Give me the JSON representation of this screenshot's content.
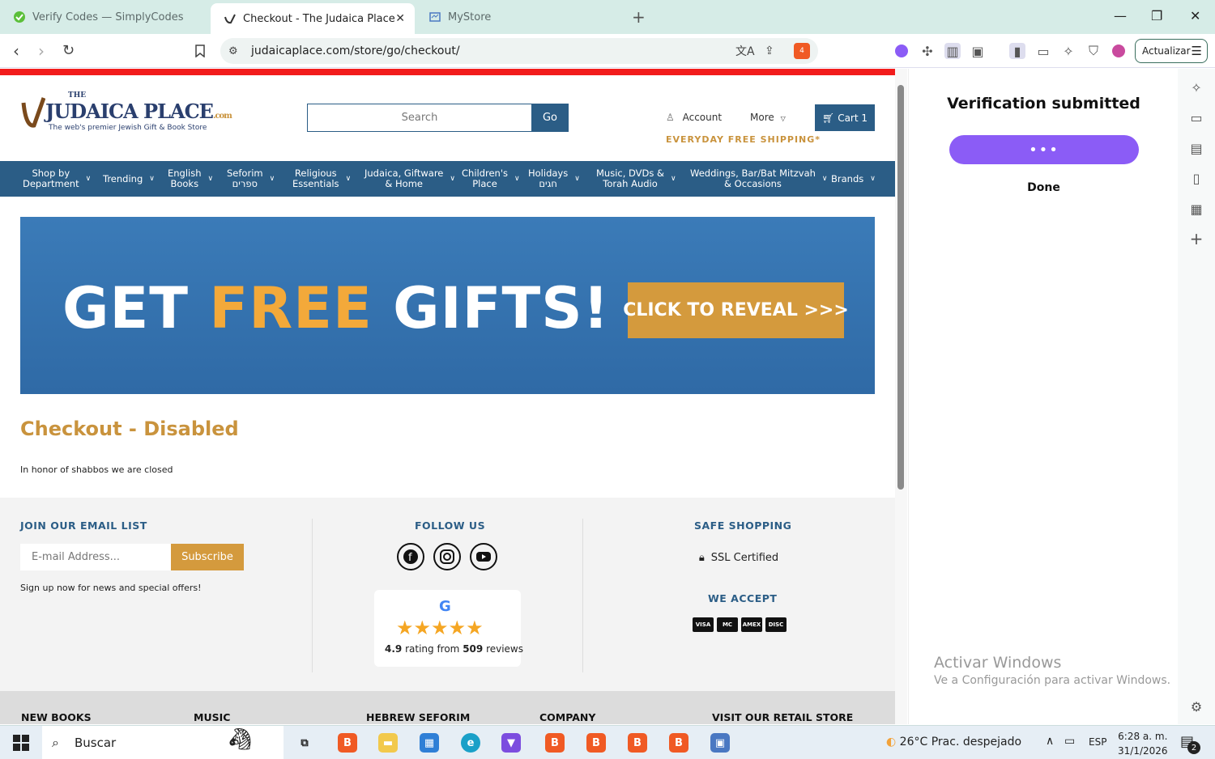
{
  "browser": {
    "tabs": [
      {
        "label": "Verify Codes — SimplyCodes",
        "active": false
      },
      {
        "label": "Checkout - The Judaica Place",
        "active": true
      },
      {
        "label": "MyStore",
        "active": false
      }
    ],
    "url": "judaicaplace.com/store/go/checkout/",
    "update_label": "Actualizar",
    "shield_count": "4"
  },
  "site": {
    "logo_the": "THE",
    "logo_main": "JUDAICA PLACE",
    "logo_com": ".com",
    "logo_tagline": "The web's premier Jewish Gift & Book Store",
    "search_placeholder": "Search",
    "go_label": "Go",
    "account_label": "Account",
    "more_label": "More",
    "cart_label": "Cart 1",
    "shipping_text": "EVERYDAY FREE SHIPPING*",
    "menu": [
      {
        "l1": "Shop by",
        "l2": "Department"
      },
      {
        "l1": "Trending",
        "l2": ""
      },
      {
        "l1": "English",
        "l2": "Books"
      },
      {
        "l1": "Seforim",
        "l2": "ספרים"
      },
      {
        "l1": "Religious",
        "l2": "Essentials"
      },
      {
        "l1": "Judaica, Giftware",
        "l2": "& Home"
      },
      {
        "l1": "Children's",
        "l2": "Place"
      },
      {
        "l1": "Holidays",
        "l2": "חגים"
      },
      {
        "l1": "Music, DVDs &",
        "l2": "Torah Audio"
      },
      {
        "l1": "Weddings, Bar/Bat Mitzvah",
        "l2": "& Occasions"
      },
      {
        "l1": "Brands",
        "l2": ""
      }
    ],
    "banner": {
      "get": "GET ",
      "free": "FREE",
      "gifts": " GIFTS!",
      "reveal": "CLICK TO REVEAL >>>"
    },
    "checkout_title": "Checkout - Disabled",
    "honor_text": "In honor of shabbos we are closed",
    "footer": {
      "email_heading": "JOIN OUR EMAIL LIST",
      "email_placeholder": "E-mail Address...",
      "subscribe_label": "Subscribe",
      "signup_text": "Sign up now for news and special offers!",
      "follow_heading": "FOLLOW US",
      "google_letter": "G",
      "stars": "★★★★★",
      "rating_value": "4.9",
      "rating_mid": " rating from ",
      "rating_count": "509",
      "rating_end": " reviews",
      "safe_heading": "SAFE SHOPPING",
      "ssl_label": "SSL Certified",
      "accept_heading": "WE ACCEPT",
      "cards": [
        "VISA",
        "MC",
        "AMEX",
        "DISC"
      ],
      "bottom_headings": [
        "NEW BOOKS",
        "MUSIC",
        "HEBREW SEFORIM",
        "COMPANY",
        "VISIT OUR RETAIL STORE"
      ]
    }
  },
  "panel": {
    "title": "Verification submitted",
    "button_dots": "•••",
    "done_label": "Done"
  },
  "watermark": {
    "line1": "Activar Windows",
    "line2": "Ve a Configuración para activar Windows."
  },
  "taskbar": {
    "search_label": "Buscar",
    "weather": "26°C  Prac. despejado",
    "lang": "ESP",
    "time": "6:28 a. m.",
    "date": "31/1/2026",
    "notif_count": "2"
  }
}
